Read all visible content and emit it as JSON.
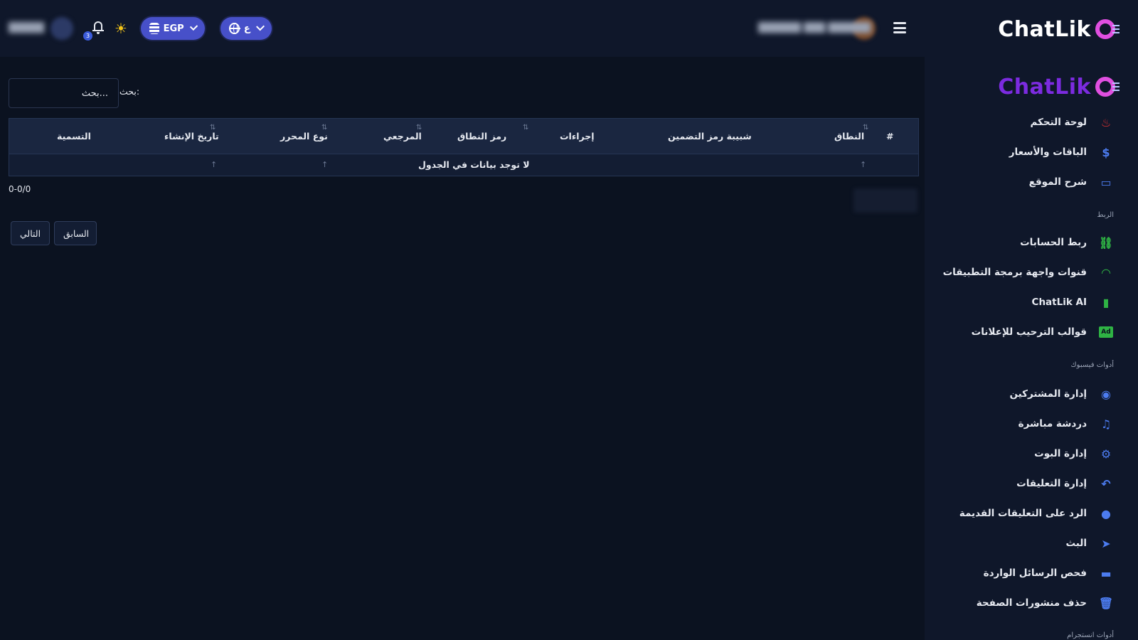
{
  "brand": {
    "name": "ChatLik"
  },
  "header": {
    "language_label": "ع",
    "currency_label": "EGP",
    "notification_count": "3"
  },
  "sidebar": {
    "items": [
      {
        "label": "لوحة التحكم",
        "icon": "fire-icon"
      },
      {
        "label": "الباقات والأسعار",
        "icon": "dollar-icon"
      },
      {
        "label": "شرح الموقع",
        "icon": "presentation-icon"
      }
    ],
    "sections": [
      {
        "title": "الربط",
        "items": [
          {
            "label": "ربط الحسابات",
            "icon": "link-icon"
          },
          {
            "label": "قنوات واجهة برمجة التطبيقات",
            "icon": "wifi-icon"
          },
          {
            "label": "ChatLik AI",
            "icon": "chip-icon"
          },
          {
            "label": "قوالب الترحيب للإعلانات",
            "icon": "ad-icon"
          }
        ]
      },
      {
        "title": "أدوات فيسبوك",
        "items": [
          {
            "label": "إدارة المشتركين",
            "icon": "user-circle-icon"
          },
          {
            "label": "دردشة مباشرة",
            "icon": "headset-icon"
          },
          {
            "label": "إدارة البوت",
            "icon": "robot-icon"
          },
          {
            "label": "إدارة التعليقات",
            "icon": "reply-all-icon"
          },
          {
            "label": "الرد على التعليقات القديمة",
            "icon": "comment-dots-icon"
          },
          {
            "label": "البث",
            "icon": "paper-plane-icon"
          },
          {
            "label": "فحص الرسائل الواردة",
            "icon": "inbox-icon"
          },
          {
            "label": "حذف منشورات الصفحة",
            "icon": "trash-icon"
          }
        ]
      },
      {
        "title": "أدوات انستجرام",
        "items": []
      }
    ]
  },
  "main": {
    "search_label": "بحث:",
    "search_placeholder": "بحث...",
    "columns": [
      "#",
      "النطاق",
      "شبيبة رمز التضمين",
      "إجراءات",
      "رمز النطاق",
      "المرجعي",
      "نوع المحرر",
      "تاريخ الإنشاء",
      "التسمية"
    ],
    "empty_message": "لا توجد بيانات في الجدول",
    "info_text": "0-0/0",
    "prev_label": "السابق",
    "next_label": "التالي"
  },
  "colors": {
    "background": "#0b1220",
    "panel": "#0f172a",
    "accent": "#4750c9",
    "brand_purple": "#7c2be0"
  }
}
